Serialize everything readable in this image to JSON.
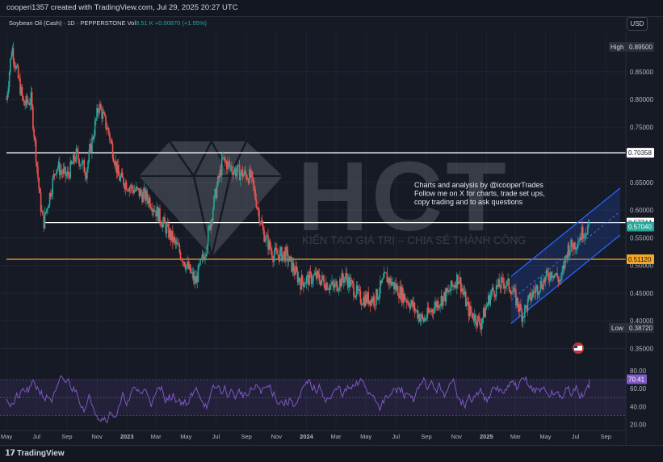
{
  "header": {
    "created_by": "cooperi1357 created with TradingView.com, Jul 29, 2025 20:27 UTC"
  },
  "symbol_info": {
    "name": "Soybean Oil (Cash) · 1D · PEPPERSTONE",
    "vol_label": "Vol",
    "vol_value": "8.51 K",
    "change": "+0.00870 (+1.55%)"
  },
  "currency": "USD",
  "watermark": {
    "logo_text": "HCT",
    "slogan": "KIẾN TẠO GIÁ TRỊ – CHIA SẺ THÀNH CÔNG"
  },
  "annotation": {
    "line1": "Charts and analysis by @icooperTrades",
    "line2": "Follow me on X for charts, trade set ups,",
    "line3": "copy trading and to ask questions"
  },
  "footer": {
    "brand": "TradingView"
  },
  "colors": {
    "background": "#161a25",
    "candle_up": "#26a69a",
    "candle_down": "#ef5350",
    "resistance_line": "#ffffff",
    "support_line": "#f5a623",
    "channel": "#2962ff",
    "rsi_line": "#7e57c2",
    "rsi_band": "#7e57c2"
  },
  "chart_data": {
    "type": "candlestick",
    "price_axis": {
      "ticks": [
        "0.85000",
        "0.80000",
        "0.75000",
        "0.65000",
        "0.60000",
        "0.55000",
        "0.50000",
        "0.45000",
        "0.40000",
        "0.35000"
      ],
      "range": [
        0.3,
        0.9
      ]
    },
    "time_axis": {
      "labels": [
        "May",
        "Jul",
        "Sep",
        "Nov",
        "2023",
        "Mar",
        "May",
        "Jul",
        "Sep",
        "Nov",
        "2024",
        "Mar",
        "May",
        "Jul",
        "Sep",
        "Nov",
        "2025",
        "Mar",
        "May",
        "Jul",
        "Sep"
      ],
      "range": [
        "2022-05-01",
        "2025-09-30"
      ]
    },
    "price_points": [
      {
        "date": "2022-05-01",
        "price": 0.8
      },
      {
        "date": "2022-05-12",
        "price": 0.895
      },
      {
        "date": "2022-06-05",
        "price": 0.79
      },
      {
        "date": "2022-06-20",
        "price": 0.8
      },
      {
        "date": "2022-07-08",
        "price": 0.62
      },
      {
        "date": "2022-07-15",
        "price": 0.575
      },
      {
        "date": "2022-08-10",
        "price": 0.68
      },
      {
        "date": "2022-09-01",
        "price": 0.66
      },
      {
        "date": "2022-09-20",
        "price": 0.7
      },
      {
        "date": "2022-10-10",
        "price": 0.67
      },
      {
        "date": "2022-11-05",
        "price": 0.79
      },
      {
        "date": "2022-11-25",
        "price": 0.74
      },
      {
        "date": "2022-12-15",
        "price": 0.66
      },
      {
        "date": "2023-01-10",
        "price": 0.64
      },
      {
        "date": "2023-02-15",
        "price": 0.62
      },
      {
        "date": "2023-03-20",
        "price": 0.57
      },
      {
        "date": "2023-04-15",
        "price": 0.53
      },
      {
        "date": "2023-05-20",
        "price": 0.47
      },
      {
        "date": "2023-06-10",
        "price": 0.53
      },
      {
        "date": "2023-06-30",
        "price": 0.63
      },
      {
        "date": "2023-07-15",
        "price": 0.69
      },
      {
        "date": "2023-08-10",
        "price": 0.67
      },
      {
        "date": "2023-09-10",
        "price": 0.66
      },
      {
        "date": "2023-10-05",
        "price": 0.56
      },
      {
        "date": "2023-10-25",
        "price": 0.52
      },
      {
        "date": "2023-11-20",
        "price": 0.52
      },
      {
        "date": "2023-12-20",
        "price": 0.47
      },
      {
        "date": "2024-01-20",
        "price": 0.48
      },
      {
        "date": "2024-02-25",
        "price": 0.46
      },
      {
        "date": "2024-03-20",
        "price": 0.48
      },
      {
        "date": "2024-04-20",
        "price": 0.44
      },
      {
        "date": "2024-05-20",
        "price": 0.44
      },
      {
        "date": "2024-06-10",
        "price": 0.48
      },
      {
        "date": "2024-07-01",
        "price": 0.46
      },
      {
        "date": "2024-08-01",
        "price": 0.43
      },
      {
        "date": "2024-08-25",
        "price": 0.4
      },
      {
        "date": "2024-09-20",
        "price": 0.43
      },
      {
        "date": "2024-10-15",
        "price": 0.45
      },
      {
        "date": "2024-11-05",
        "price": 0.48
      },
      {
        "date": "2024-11-25",
        "price": 0.42
      },
      {
        "date": "2024-12-20",
        "price": 0.395
      },
      {
        "date": "2025-01-10",
        "price": 0.45
      },
      {
        "date": "2025-02-05",
        "price": 0.47
      },
      {
        "date": "2025-02-20",
        "price": 0.46
      },
      {
        "date": "2025-03-15",
        "price": 0.41
      },
      {
        "date": "2025-04-05",
        "price": 0.45
      },
      {
        "date": "2025-04-25",
        "price": 0.47
      },
      {
        "date": "2025-05-15",
        "price": 0.49
      },
      {
        "date": "2025-06-01",
        "price": 0.47
      },
      {
        "date": "2025-06-15",
        "price": 0.53
      },
      {
        "date": "2025-07-01",
        "price": 0.54
      },
      {
        "date": "2025-07-15",
        "price": 0.56
      },
      {
        "date": "2025-07-29",
        "price": 0.5704
      }
    ],
    "horizontal_levels": [
      {
        "value": 0.70358,
        "label": "0.70358",
        "color": "#ffffff",
        "from": "2022-05-01"
      },
      {
        "value": 0.57744,
        "label": "0.57744",
        "color": "#ffffff",
        "from": "2022-07-15"
      },
      {
        "value": 0.5112,
        "label": "0.51120",
        "color": "#f5a623",
        "from": "2022-05-01"
      }
    ],
    "current_price": {
      "value": 0.5704,
      "label": "0.57040"
    },
    "high": {
      "value": 0.895,
      "label": "0.89500",
      "tag": "High"
    },
    "low": {
      "value": 0.3872,
      "label": "0.38720",
      "tag": "Low"
    },
    "channel": {
      "start": "2025-02-20",
      "end": "2025-09-30",
      "lower_start": 0.395,
      "lower_end": 0.555,
      "upper_start": 0.48,
      "upper_end": 0.64
    },
    "rsi": {
      "ticks": [
        "80.00",
        "60.00",
        "40.00",
        "20.00"
      ],
      "range": [
        15,
        88
      ],
      "band": [
        30,
        70
      ],
      "current": {
        "value": 70.41,
        "label": "70.41"
      }
    }
  }
}
